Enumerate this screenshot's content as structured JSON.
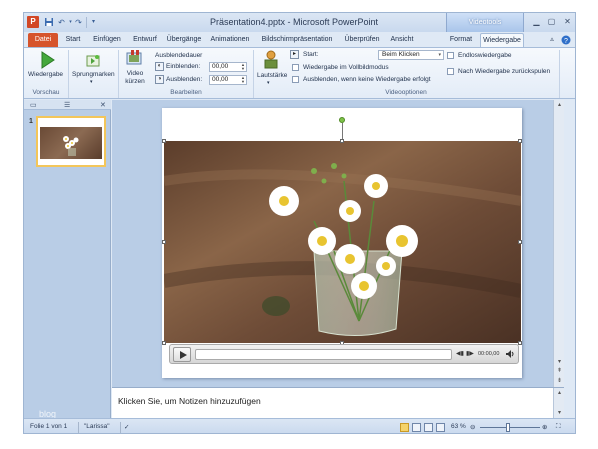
{
  "titlebar": {
    "title": "Präsentation4.pptx - Microsoft PowerPoint",
    "context_header": "Videotools",
    "app_icon_letter": "P",
    "qat": [
      "save-icon",
      "undo-icon",
      "redo-icon",
      "customize-icon"
    ],
    "window_controls": [
      "minimize",
      "maximize",
      "close"
    ]
  },
  "tabs": [
    {
      "label": "Datei",
      "type": "file"
    },
    {
      "label": "Start"
    },
    {
      "label": "Einfügen"
    },
    {
      "label": "Entwurf"
    },
    {
      "label": "Übergänge"
    },
    {
      "label": "Animationen"
    },
    {
      "label": "Bildschirmpräsentation"
    },
    {
      "label": "Überprüfen"
    },
    {
      "label": "Ansicht"
    },
    {
      "label": "Format"
    },
    {
      "label": "Wiedergabe",
      "active": true
    }
  ],
  "ribbon": {
    "vorschau": {
      "play_label": "Wiedergabe",
      "group_label": "Vorschau"
    },
    "textmarken": {
      "label": "Sprungmarken"
    },
    "bearbeiten": {
      "trim_label_1": "Video",
      "trim_label_2": "kürzen",
      "fade_title": "Ausblendedauer",
      "fade_in_label": "Einblenden:",
      "fade_in_value": "00,00",
      "fade_out_label": "Ausblenden:",
      "fade_out_value": "00,00",
      "group_label": "Bearbeiten"
    },
    "videooptionen": {
      "volume_label": "Lautstärke",
      "start_label": "Start:",
      "start_value": "Beim Klicken",
      "fullscreen_label": "Wiedergabe im Vollbildmodus",
      "hide_label": "Ausblenden, wenn keine Wiedergabe erfolgt",
      "loop_label": "Endloswiedergabe",
      "rewind_label": "Nach Wiedergabe zurückspulen",
      "group_label": "Videooptionen"
    }
  },
  "left_pane": {
    "slide_number": "1",
    "watermark": "blog"
  },
  "video_controls": {
    "time": "00:00,00"
  },
  "notes": {
    "placeholder": "Klicken Sie, um Notizen hinzuzufügen"
  },
  "statusbar": {
    "slide_info": "Folie 1 von 1",
    "theme": "\"Larissa\"",
    "zoom": "63 %"
  },
  "colors": {
    "file_tab": "#d6542c",
    "context_tab": "#a9c5ea",
    "thumbnail_border": "#f3c65a"
  }
}
